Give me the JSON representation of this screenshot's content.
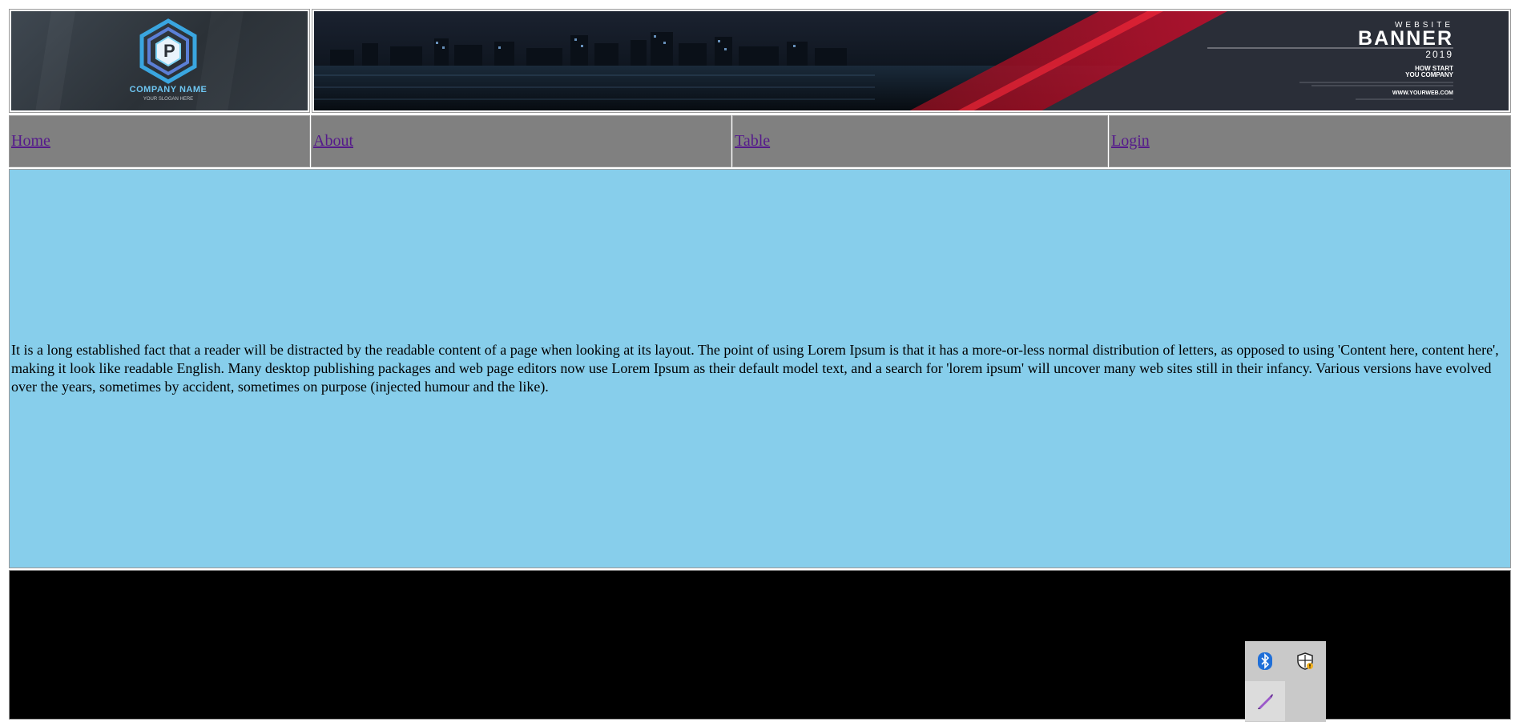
{
  "header": {
    "logo": {
      "company_name": "COMPANY NAME",
      "slogan": "YOUR SLOGAN HERE"
    },
    "banner": {
      "eyebrow": "WEBSITE",
      "title": "BANNER",
      "year": "2019",
      "subtitle_line1": "HOW START",
      "subtitle_line2": "YOU COMPANY",
      "url": "WWW.YOURWEB.COM"
    }
  },
  "nav": {
    "items": [
      {
        "label": "Home"
      },
      {
        "label": "About"
      },
      {
        "label": "Table"
      },
      {
        "label": "Login"
      }
    ]
  },
  "content": {
    "paragraph": "It is a long established fact that a reader will be distracted by the readable content of a page when looking at its layout. The point of using Lorem Ipsum is that it has a more-or-less normal distribution of letters, as opposed to using 'Content here, content here', making it look like readable English. Many desktop publishing packages and web page editors now use Lorem Ipsum as their default model text, and a search for 'lorem ipsum' will uncover many web sites still in their infancy. Various versions have evolved over the years, sometimes by accident, sometimes on purpose (injected humour and the like)."
  },
  "tray": {
    "icons": [
      "bluetooth-icon",
      "security-shield-icon",
      "pen-icon"
    ]
  },
  "colors": {
    "nav_bg": "#808080",
    "content_bg": "#87ceeb",
    "footer_bg": "#000000",
    "link": "#551a8b",
    "banner_red": "#c8102e"
  }
}
